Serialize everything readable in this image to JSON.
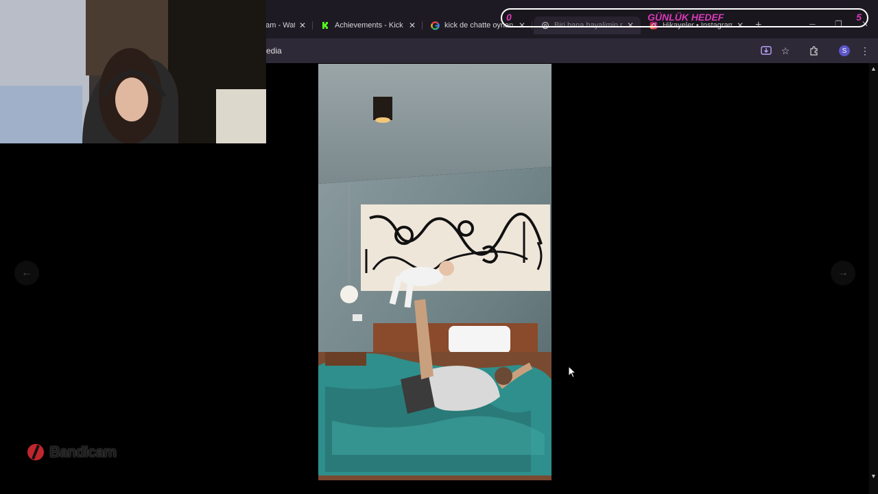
{
  "browser": {
    "tabs": [
      {
        "label": "...am - Wat",
        "favicon": "globe-icon",
        "active": false
      },
      {
        "label": "Achievements - Kick D",
        "favicon": "kick-logo-icon",
        "active": false
      },
      {
        "label": "kick de chatte oynan",
        "favicon": "google-logo-icon",
        "active": false
      },
      {
        "label": "Biri bana hayalimin ne",
        "favicon": "chatgpt-icon",
        "active": true
      },
      {
        "label": "Hikayeler • Instagram",
        "favicon": "instagram-icon",
        "active": false
      }
    ],
    "new_tab": "+",
    "address": "edia"
  },
  "overlay": {
    "goal_title": "GÜNLÜK HEDEF",
    "goal_min": "0",
    "goal_max": "5",
    "watermark": "Bandicam"
  },
  "viewer": {
    "prev_arrow": "←",
    "next_arrow": "→"
  },
  "colors": {
    "accent": "#d93ab8",
    "tabbar": "#1e1a24",
    "toolbar": "#2e2937"
  }
}
